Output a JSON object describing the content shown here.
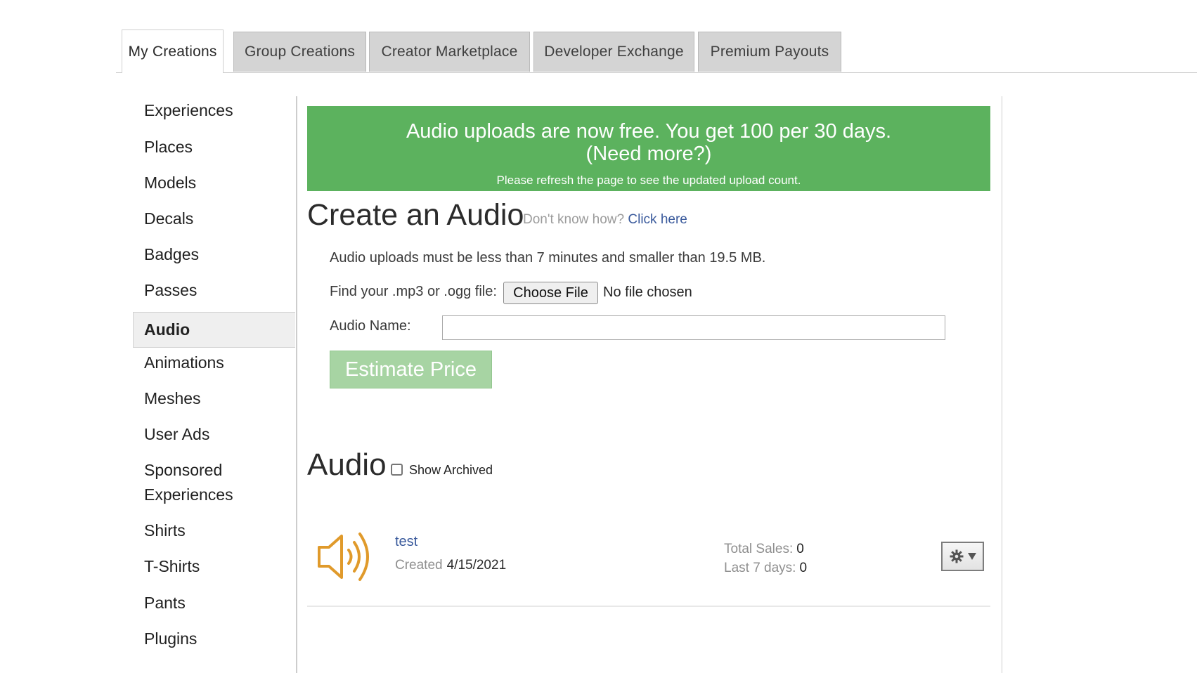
{
  "tabs": [
    {
      "label": "My Creations",
      "active": true
    },
    {
      "label": "Group Creations",
      "active": false
    },
    {
      "label": "Creator Marketplace",
      "active": false
    },
    {
      "label": "Developer Exchange",
      "active": false
    },
    {
      "label": "Premium Payouts",
      "active": false
    }
  ],
  "sidebar": {
    "active": "Audio",
    "items": [
      {
        "label": "Experiences"
      },
      {
        "label": "Places"
      },
      {
        "label": "Models"
      },
      {
        "label": "Decals"
      },
      {
        "label": "Badges"
      },
      {
        "label": "Passes"
      },
      {
        "label": "Audio"
      },
      {
        "label": "Animations"
      },
      {
        "label": "Meshes"
      },
      {
        "label": "User Ads"
      },
      {
        "label": "Sponsored"
      },
      {
        "label": "Experiences"
      },
      {
        "label": "Shirts"
      },
      {
        "label": "T-Shirts"
      },
      {
        "label": "Pants"
      },
      {
        "label": "Plugins"
      }
    ]
  },
  "banner": {
    "line1": "Audio uploads are now free. You get 100 per 30 days.",
    "line2": "(Need more?)",
    "line3": "Please refresh the page to see the updated upload count.",
    "color": "#5cb25e"
  },
  "create": {
    "title": "Create an Audio",
    "help_prefix": "Don't know how?",
    "help_link": "Click here",
    "limits": "Audio uploads must be less than 7 minutes and smaller than 19.5 MB.",
    "file_label": "Find your .mp3 or .ogg file:",
    "choose_file": "Choose File",
    "no_file": "No file chosen",
    "name_label": "Audio Name:",
    "name_value": "",
    "estimate_button": "Estimate Price"
  },
  "list": {
    "title": "Audio",
    "show_archived_label": "Show Archived",
    "show_archived_checked": false,
    "items": [
      {
        "icon": "speaker-icon",
        "name": "test",
        "created_label": "Created",
        "created": "4/15/2021",
        "total_sales_label": "Total Sales:",
        "total_sales": "0",
        "last7_label": "Last 7 days:",
        "last7": "0"
      }
    ]
  }
}
